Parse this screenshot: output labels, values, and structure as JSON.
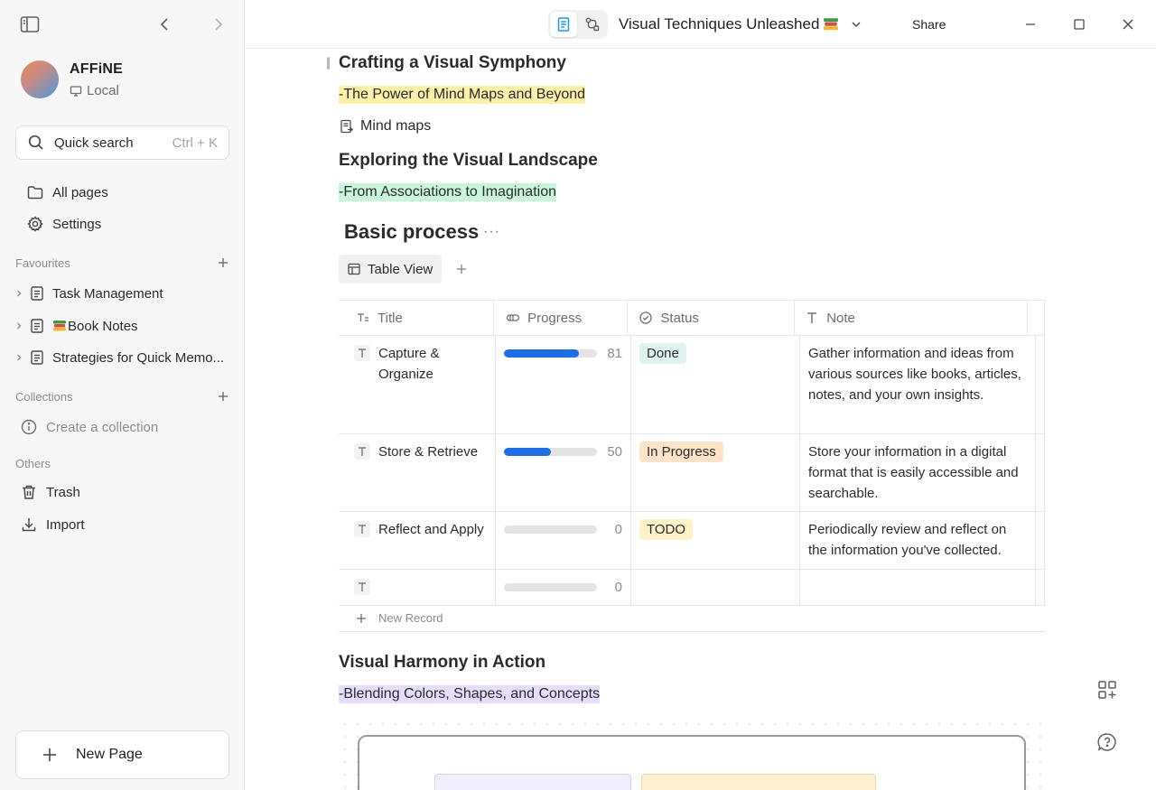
{
  "sidebar": {
    "workspace": {
      "name": "AFFiNE",
      "type": "Local"
    },
    "quick_search": {
      "label": "Quick search",
      "shortcut": "Ctrl + K"
    },
    "nav": [
      {
        "label": "All pages",
        "icon": "folder-icon"
      },
      {
        "label": "Settings",
        "icon": "gear-icon"
      }
    ],
    "favourites": {
      "title": "Favourites",
      "items": [
        {
          "label": "Task Management"
        },
        {
          "label": "Book Notes"
        },
        {
          "label": "Strategies for Quick Memo..."
        }
      ]
    },
    "collections": {
      "title": "Collections",
      "create_label": "Create a collection"
    },
    "others": {
      "title": "Others",
      "items": [
        {
          "label": "Trash",
          "icon": "trash-icon"
        },
        {
          "label": "Import",
          "icon": "import-icon"
        }
      ]
    },
    "new_page_label": "New Page"
  },
  "topbar": {
    "doc_title": "Visual Techniques Unleashed",
    "share_label": "Share"
  },
  "editor": {
    "heading1": "Crafting a Visual Symphony",
    "highlight1": "-The Power of Mind Maps and Beyond",
    "linked_doc": "Mind maps",
    "heading2": "Exploring the Visual Landscape",
    "highlight2": "-From Associations to Imagination",
    "database": {
      "title": "Basic process",
      "view_label": "Table View",
      "columns": [
        "Title",
        "Progress",
        "Status",
        "Note"
      ],
      "rows": [
        {
          "title": "Capture & Organize",
          "progress": 81,
          "status": "Done",
          "note": "Gather information and ideas from various sources like books, articles, notes, and your own insights."
        },
        {
          "title": "Store & Retrieve",
          "progress": 50,
          "status": "In Progress",
          "note": "Store your information in a digital format that is easily accessible and searchable."
        },
        {
          "title": "Reflect and Apply",
          "progress": 0,
          "status": "TODO",
          "note": "Periodically review and reflect on the information you've collected."
        },
        {
          "title": "",
          "progress": 0,
          "status": "",
          "note": ""
        }
      ],
      "new_record_label": "New Record"
    },
    "heading3": "Visual Harmony in Action",
    "highlight3": "-Blending Colors, Shapes, and Concepts"
  },
  "colors": {
    "highlight_yellow": "#fdf0a8",
    "highlight_green": "#c9f5dc",
    "highlight_purple": "#e6dcfb",
    "progress_blue": "#1e6fe6",
    "status_done": "#dff4f1",
    "status_in_progress": "#fde3c8",
    "status_todo": "#fdf1c7",
    "accent": "#1e96eb"
  }
}
